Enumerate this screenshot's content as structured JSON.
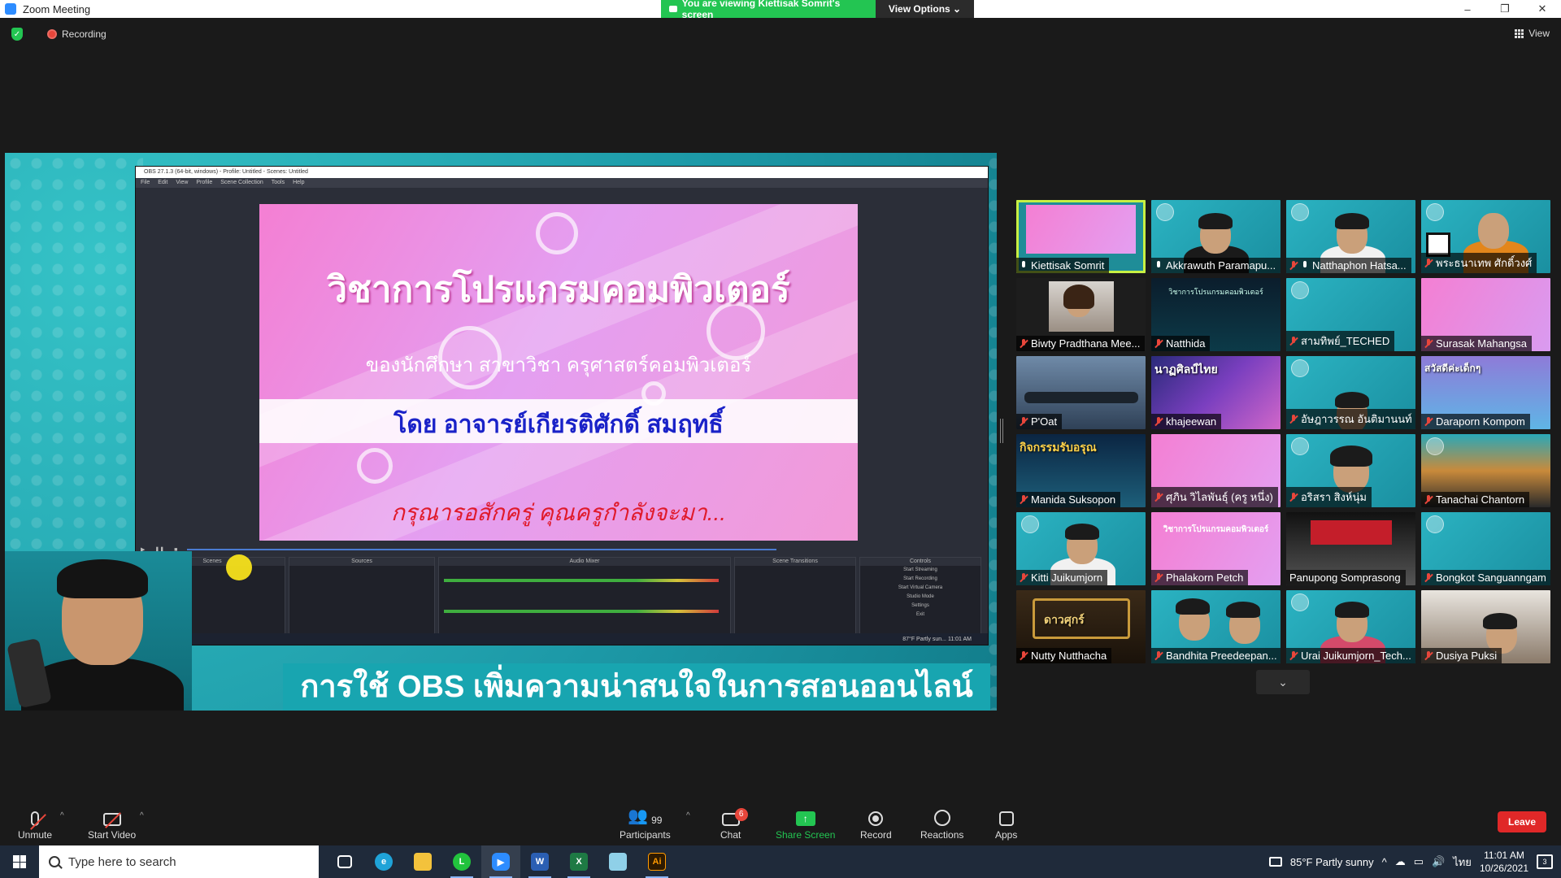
{
  "window": {
    "title": "Zoom Meeting",
    "buttons": [
      "–",
      "❐",
      "✕"
    ]
  },
  "banner": {
    "viewing_text": "You are viewing Kiettisak Somrit's screen",
    "view_options": "View Options ⌄"
  },
  "status": {
    "recording": "Recording",
    "view": "View"
  },
  "share": {
    "obs_title": "OBS 27.1.3 (64-bit, windows) - Profile: Untitled - Scenes: Untitled",
    "obs_menu": [
      "File",
      "Edit",
      "View",
      "Profile",
      "Scene Collection",
      "Tools",
      "Help"
    ],
    "slide_title": "วิชาการโปรแกรมคอมพิวเตอร์",
    "slide_subtitle": "ของนักศึกษา สาขาวิชา ครุศาสตร์คอมพิวเตอร์",
    "slide_author": "โดย อาจารย์เกียรติศักดิ์ สมฤทธิ์",
    "slide_wait": "กรุณารอสักครู่ คุณครูกำลังจะมา...",
    "obs_docks": [
      "Scenes",
      "Sources",
      "Audio Mixer",
      "Scene Transitions",
      "Controls"
    ],
    "obs_controls": [
      "Start Streaming",
      "Start Recording",
      "Start Virtual Camera",
      "Studio Mode",
      "Settings",
      "Exit"
    ],
    "obs_taskbar_text": "87°F Partly sun...  11:01 AM",
    "caption": "การใช้ OBS เพิ่มความน่าสนใจในการสอนออนไลน์"
  },
  "participants_tiles": [
    {
      "name": "Kiettisak Somrit",
      "mic": "on",
      "active": true
    },
    {
      "name": "Akkrawuth Paramapu...",
      "mic": "on"
    },
    {
      "name": "Natthaphon Hatsa...",
      "mic": "on",
      "muted_extra": true
    },
    {
      "name": "พระธนาเทพ ศักดิ์วงศ์",
      "mic": "off"
    },
    {
      "name": "Biwty Pradthana Mee...",
      "mic": "off"
    },
    {
      "name": "Natthida",
      "mic": "off"
    },
    {
      "name": "สามทิพย์_TECHED",
      "mic": "off"
    },
    {
      "name": "Surasak Mahangsa",
      "mic": "off"
    },
    {
      "name": "P'Oat",
      "mic": "off"
    },
    {
      "name": "khajeewan",
      "mic": "off"
    },
    {
      "name": "อัษฎาวรรณ อันติมานนท์",
      "mic": "off"
    },
    {
      "name": "Daraporn Kompom",
      "mic": "off"
    },
    {
      "name": "Manida Suksopon",
      "mic": "off"
    },
    {
      "name": "ศุภิน วิไลพันธุ์ (ครู หนึ่ง)",
      "mic": "off"
    },
    {
      "name": "อริสรา สิงห์นุ่ม",
      "mic": "off"
    },
    {
      "name": "Tanachai Chantorn",
      "mic": "off"
    },
    {
      "name": "Kitti Juikumjorn",
      "mic": "off"
    },
    {
      "name": "Phalakorn Petch",
      "mic": "off"
    },
    {
      "name": "Panupong Somprasong",
      "mic": "none"
    },
    {
      "name": "Bongkot Sanguanngam",
      "mic": "off"
    },
    {
      "name": "Nutty Nutthacha",
      "mic": "off"
    },
    {
      "name": "Bandhita Preedeepan...",
      "mic": "off"
    },
    {
      "name": "Urai Juikumjorn_Tech...",
      "mic": "off"
    },
    {
      "name": "Dusiya Puksi",
      "mic": "off"
    }
  ],
  "tile_overlays": {
    "natthida_slide": "วิชาการโปรแกรมคอมพิวเตอร์",
    "khajeewan_text": "นาฏศิลป์ไทย",
    "daraporn_text": "สวัสดีค่ะเด็กๆ",
    "manida_text": "กิจกรรมรับอรุณ",
    "phalakorn_text": "วิชาการโปรแกรมคอมพิวเตอร์",
    "nutty_text": "ดาวศุกร์"
  },
  "toolbar": {
    "unmute": "Unmute",
    "start_video": "Start Video",
    "participants": "Participants",
    "participants_count": "99",
    "chat": "Chat",
    "chat_badge": "6",
    "share_screen": "Share Screen",
    "record": "Record",
    "reactions": "Reactions",
    "apps": "Apps",
    "leave": "Leave"
  },
  "taskbar": {
    "search_placeholder": "Type here to search",
    "weather": "85°F  Partly sunny",
    "lang": "ไทย",
    "time": "11:01 AM",
    "date": "10/26/2021",
    "notif_count": "3"
  },
  "colors": {
    "zoom_green": "#23c552",
    "leave_red": "#e02828",
    "active_outline": "#c7f043",
    "share_bg": "#1d9aa8"
  }
}
